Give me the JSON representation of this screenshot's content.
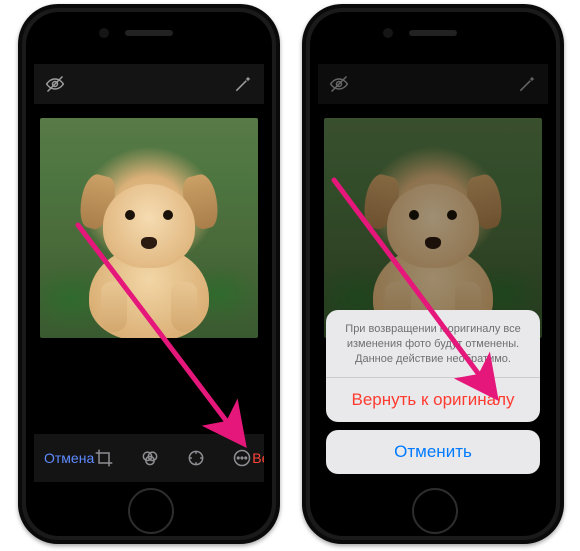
{
  "colors": {
    "cancel": "#5e8bff",
    "revert": "#ff453a",
    "destructive": "#ff3b30",
    "primary": "#007aff",
    "arrow": "#e6177a"
  },
  "phone_left": {
    "top": {
      "eye_icon": "eye-off-icon",
      "wand_icon": "magic-wand-icon"
    },
    "photo_subject": "puppy",
    "bottombar": {
      "cancel": "Отмена",
      "revert": "Вернуть",
      "tools": {
        "crop": "crop-icon",
        "filters": "filters-icon",
        "adjust": "adjust-icon",
        "more": "more-icon"
      }
    }
  },
  "phone_right": {
    "top": {
      "eye_icon": "eye-off-icon",
      "wand_icon": "magic-wand-icon"
    },
    "photo_subject": "puppy",
    "sheet": {
      "message": "При возвращении к оригиналу все изменения фото будут отменены. Данное действие необратимо.",
      "revert_button": "Вернуть к оригиналу",
      "cancel_button": "Отменить"
    }
  },
  "annotations": {
    "arrow1_target": "revert-button",
    "arrow2_target": "revert-to-original-button"
  }
}
